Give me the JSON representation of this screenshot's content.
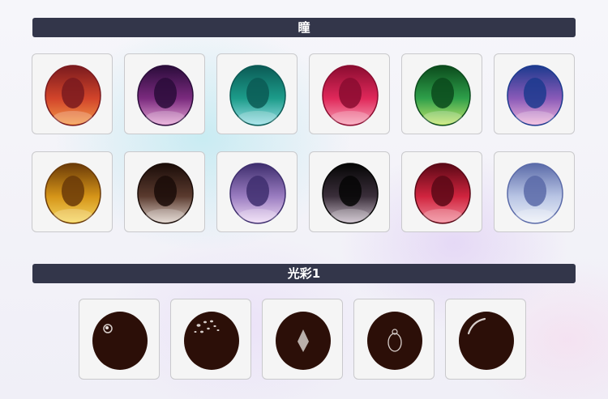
{
  "sections": [
    {
      "title": "瞳"
    },
    {
      "title": "光彩1"
    }
  ],
  "eye_options": [
    {
      "name": "eye-swatch-orange",
      "colors": [
        "#7a1a1e",
        "#d2442a",
        "#f39a48"
      ]
    },
    {
      "name": "eye-swatch-purple",
      "colors": [
        "#2a0c3a",
        "#7a2a7e",
        "#e7a6d6"
      ]
    },
    {
      "name": "eye-swatch-teal",
      "colors": [
        "#0b5a55",
        "#1c9c8a",
        "#9ae0e8"
      ]
    },
    {
      "name": "eye-swatch-rose",
      "colors": [
        "#8a0c30",
        "#e0285a",
        "#f7a2b8"
      ]
    },
    {
      "name": "eye-swatch-green",
      "colors": [
        "#0b4a1c",
        "#2ea04a",
        "#c8e86e"
      ]
    },
    {
      "name": "eye-swatch-blue-pink",
      "colors": [
        "#1c3a8e",
        "#8a5ab8",
        "#f2b8dc"
      ]
    },
    {
      "name": "eye-swatch-gold",
      "colors": [
        "#6a3a08",
        "#d59418",
        "#f6d860"
      ]
    },
    {
      "name": "eye-swatch-dark-brown",
      "colors": [
        "#1a0c08",
        "#5a3a2e",
        "#e0d4cc"
      ]
    },
    {
      "name": "eye-swatch-lavender",
      "colors": [
        "#3e2e6e",
        "#9a7cc0",
        "#f0dcf6"
      ]
    },
    {
      "name": "eye-swatch-black-sparkle",
      "colors": [
        "#050505",
        "#3a2e3a",
        "#c8bcc8"
      ]
    },
    {
      "name": "eye-swatch-crimson",
      "colors": [
        "#5a0816",
        "#d0243e",
        "#f28a9a"
      ]
    },
    {
      "name": "eye-swatch-pale-blue",
      "colors": [
        "#5a6aa8",
        "#b8c4e4",
        "#eef2f8"
      ]
    }
  ],
  "highlight_options": [
    {
      "name": "highlight-swatch-dot-circle"
    },
    {
      "name": "highlight-swatch-speckles"
    },
    {
      "name": "highlight-swatch-diamond"
    },
    {
      "name": "highlight-swatch-ring"
    },
    {
      "name": "highlight-swatch-arc"
    }
  ]
}
